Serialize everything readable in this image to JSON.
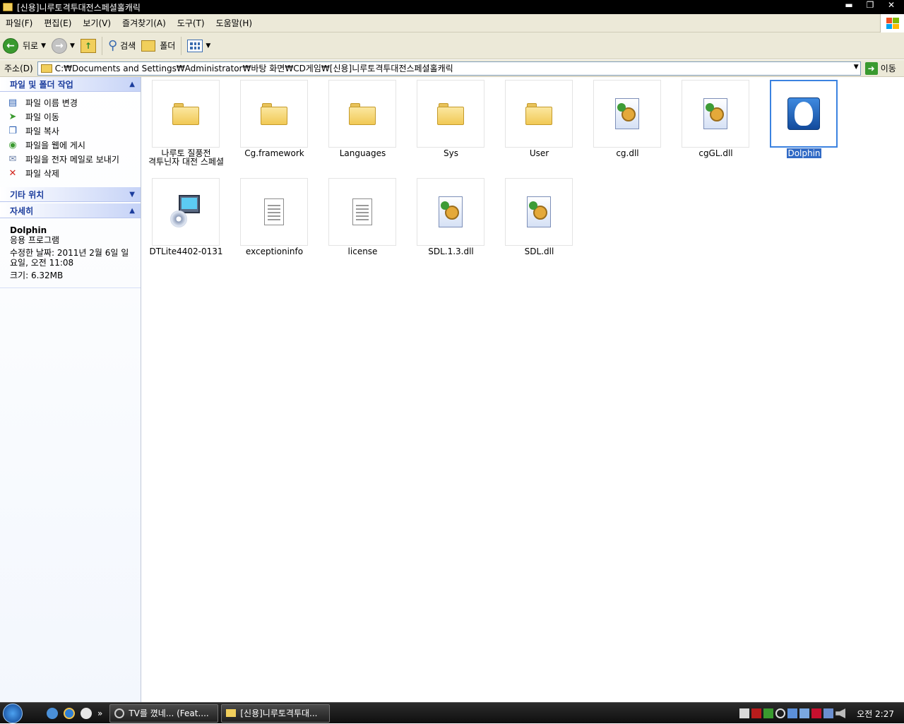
{
  "window": {
    "title": "[신용]니루토격투대전스페셜홀캐릭",
    "buttons": {
      "minimize": "▬",
      "restore": "❐",
      "close": "✕"
    }
  },
  "menu": [
    "파일(F)",
    "편집(E)",
    "보기(V)",
    "즐겨찾기(A)",
    "도구(T)",
    "도움말(H)"
  ],
  "toolbar": {
    "back": "뒤로",
    "search": "검색",
    "folders": "폴더"
  },
  "address": {
    "label": "주소(D)",
    "path": "C:₩Documents and Settings₩Administrator₩바탕 화면₩CD게임₩[신용]니루토격투대전스페셜홀캐릭",
    "go": "이동"
  },
  "sidebar": {
    "file_tasks_title": "파일 및 폴더 작업",
    "tasks": [
      {
        "label": "파일 이름 변경",
        "icon": "rename-icon"
      },
      {
        "label": "파일 이동",
        "icon": "move-icon"
      },
      {
        "label": "파일 복사",
        "icon": "copy-icon"
      },
      {
        "label": "파일을 웹에 게시",
        "icon": "publish-web-icon"
      },
      {
        "label": "파일을 전자 메일로 보내기",
        "icon": "email-icon"
      },
      {
        "label": "파일 삭제",
        "icon": "delete-icon"
      }
    ],
    "other_places_title": "기타 위치",
    "details_title": "자세히",
    "details": {
      "name": "Dolphin",
      "type": "응용 프로그램",
      "modified": "수정한 날짜: 2011년 2월 6일 일요일, 오전 11:08",
      "size": "크기: 6.32MB"
    }
  },
  "files": [
    {
      "name": "나루토 질풍전\n격투닌자 대전 스페셜",
      "type": "folder"
    },
    {
      "name": "Cg.framework",
      "type": "folder"
    },
    {
      "name": "Languages",
      "type": "folder"
    },
    {
      "name": "Sys",
      "type": "folder"
    },
    {
      "name": "User",
      "type": "folder"
    },
    {
      "name": "cg.dll",
      "type": "dll"
    },
    {
      "name": "cgGL.dll",
      "type": "dll"
    },
    {
      "name": "Dolphin",
      "type": "exe",
      "selected": true
    },
    {
      "name": "DTLite4402-0131",
      "type": "setup"
    },
    {
      "name": "exceptioninfo",
      "type": "text"
    },
    {
      "name": "license",
      "type": "text"
    },
    {
      "name": "SDL.1.3.dll",
      "type": "dll"
    },
    {
      "name": "SDL.dll",
      "type": "dll"
    }
  ],
  "taskbar": {
    "overflow": "»",
    "buttons": [
      "TV를 꼈네... (Feat....",
      "[신용]니루토격투대..."
    ],
    "clock": "오전 2:27"
  },
  "colors": {
    "selection": "#316ac5",
    "panel_header_text": "#1c3d9d",
    "title_bg": "#000000"
  }
}
